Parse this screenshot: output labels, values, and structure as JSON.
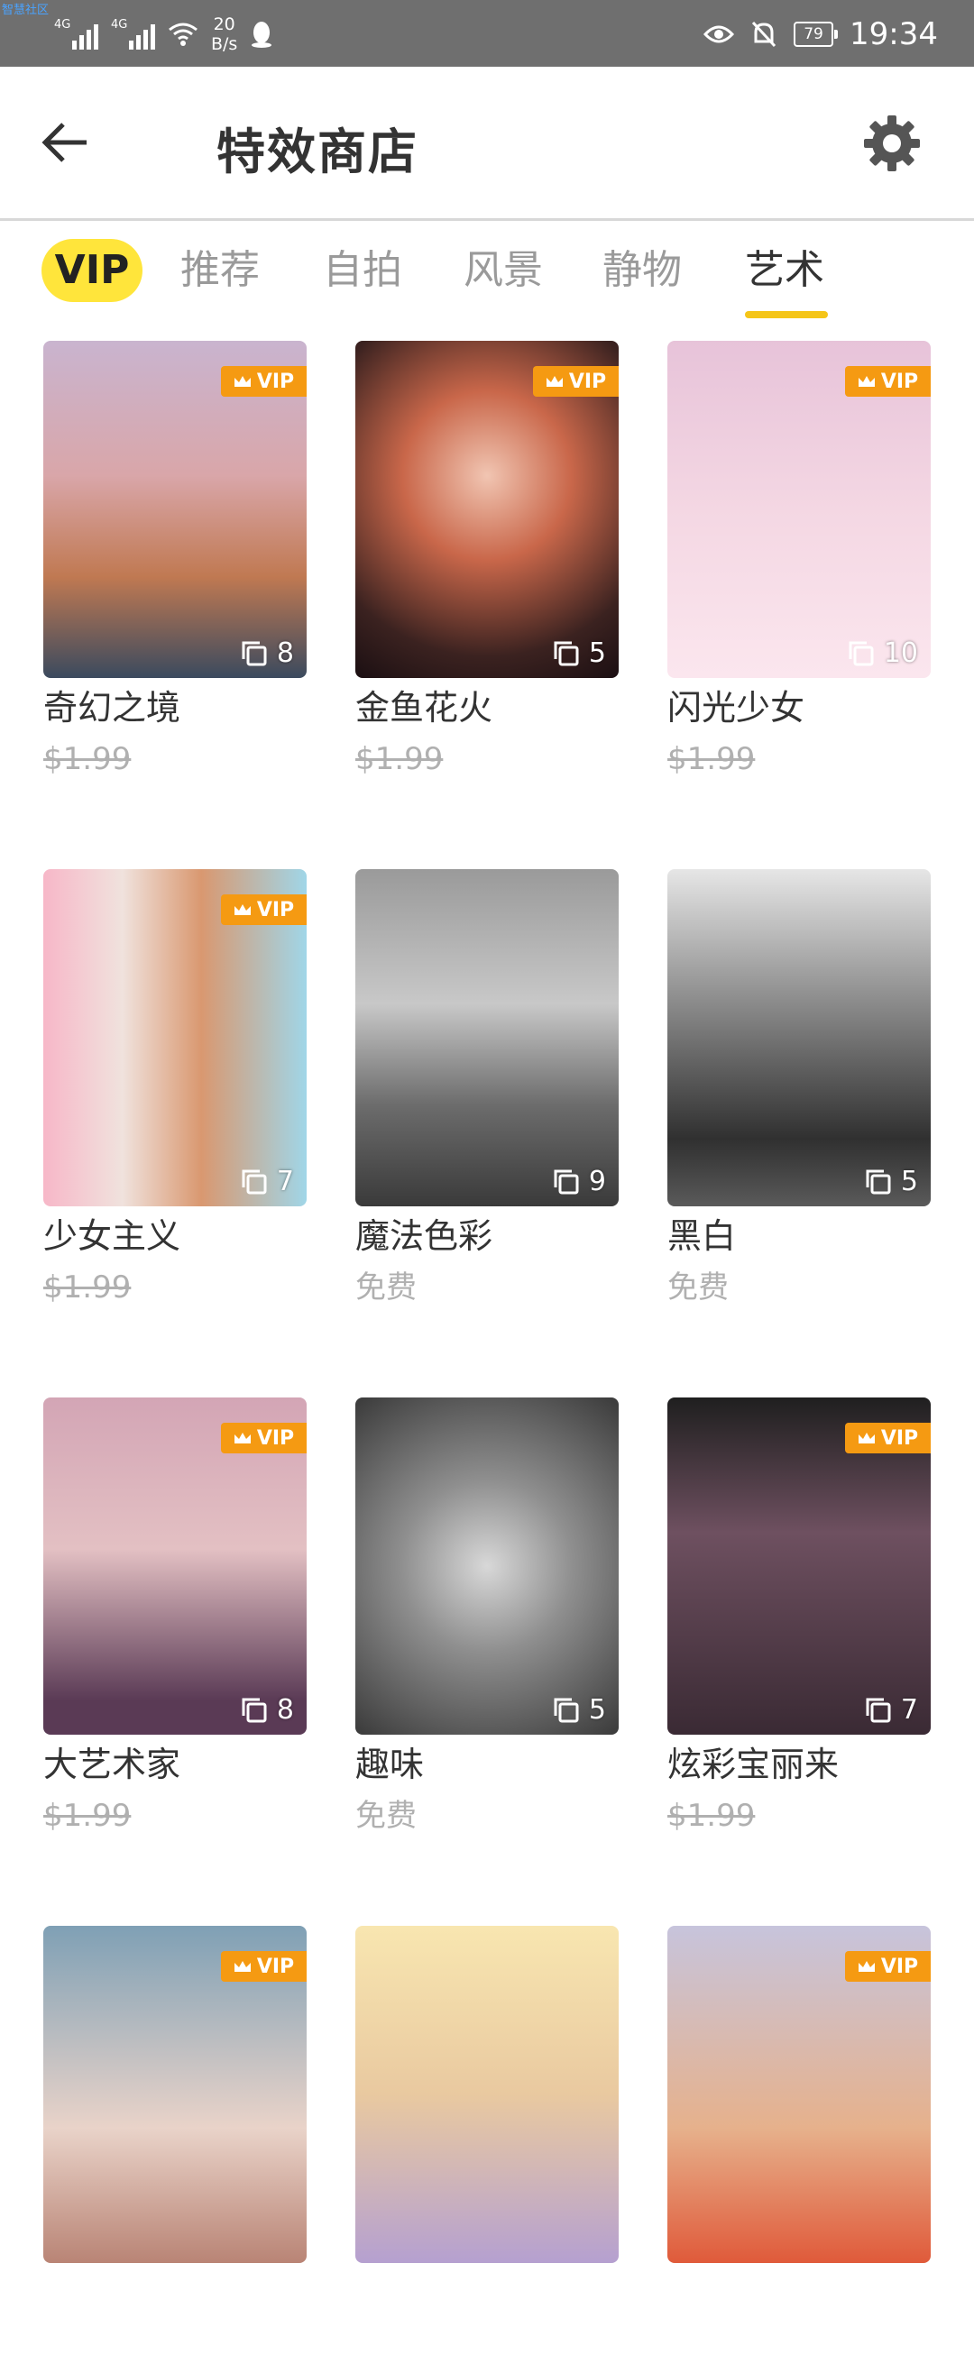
{
  "status": {
    "tiny_link": "智慧社区",
    "signal1_tag": "4G",
    "signal2_tag": "4G",
    "net_speed_value": "20",
    "net_speed_unit": "B/s",
    "battery": "79",
    "time": "19:34"
  },
  "header": {
    "title": "特效商店",
    "back_icon": "back-arrow-icon",
    "settings_icon": "gear-icon"
  },
  "tabs": {
    "vip": "VIP",
    "items": [
      "推荐",
      "自拍",
      "风景",
      "静物",
      "艺术"
    ],
    "active_index": 4,
    "accent_color": "#f5c518"
  },
  "badge_text": "VIP",
  "products": [
    {
      "name": "奇幻之境",
      "price": "$1.99",
      "count": "8",
      "vip": true
    },
    {
      "name": "金鱼花火",
      "price": "$1.99",
      "count": "5",
      "vip": true
    },
    {
      "name": "闪光少女",
      "price": "$1.99",
      "count": "10",
      "vip": true
    },
    {
      "name": "少女主义",
      "price": "$1.99",
      "count": "7",
      "vip": true
    },
    {
      "name": "魔法色彩",
      "price": "免费",
      "count": "9",
      "vip": false
    },
    {
      "name": "黑白",
      "price": "免费",
      "count": "5",
      "vip": false
    },
    {
      "name": "大艺术家",
      "price": "$1.99",
      "count": "8",
      "vip": true
    },
    {
      "name": "趣味",
      "price": "免费",
      "count": "5",
      "vip": false
    },
    {
      "name": "炫彩宝丽来",
      "price": "$1.99",
      "count": "7",
      "vip": true
    },
    {
      "name": "",
      "price": "",
      "count": "",
      "vip": true
    },
    {
      "name": "",
      "price": "",
      "count": "",
      "vip": false
    },
    {
      "name": "",
      "price": "",
      "count": "",
      "vip": true
    }
  ]
}
